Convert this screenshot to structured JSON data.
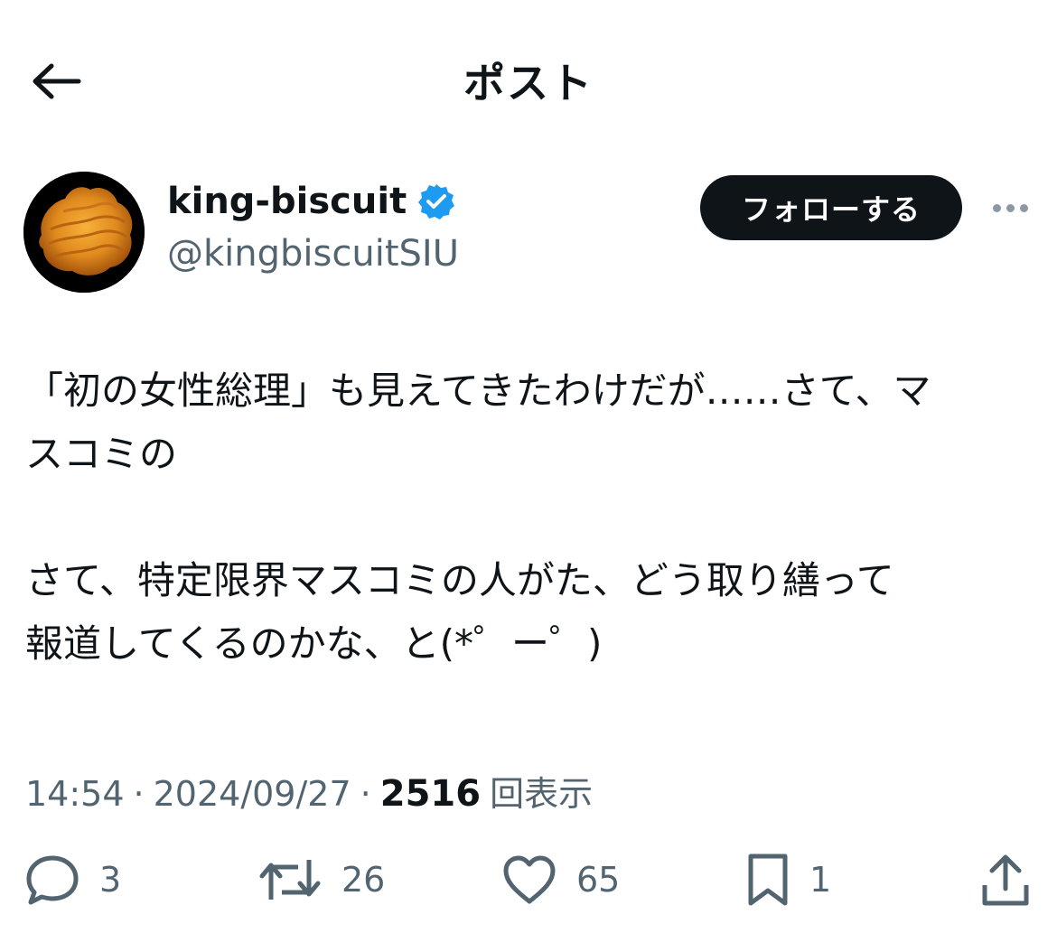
{
  "header": {
    "title": "ポスト",
    "back_icon": "arrow-left-icon"
  },
  "author": {
    "display_name": "king-biscuit",
    "handle": "@kingbiscuitSIU",
    "verified": true,
    "verified_color": "#1d9bf0",
    "follow_label": "フォローする"
  },
  "post": {
    "lines": [
      "「初の女性総理」も見えてきたわけだが……さて、マ",
      "スコミの",
      "",
      "さて、特定限界マスコミの人がた、どう取り繕って",
      "報道してくるのかな、と(*゜ー゜)"
    ]
  },
  "meta": {
    "time": "14:54",
    "separator": "·",
    "date": "2024/09/27",
    "views_count": "2516",
    "views_label": "回表示"
  },
  "actions": {
    "reply_count": "3",
    "repost_count": "26",
    "like_count": "65",
    "bookmark_count": "1"
  },
  "colors": {
    "text": "#0f1419",
    "secondary": "#536471",
    "accent": "#1d9bf0"
  }
}
